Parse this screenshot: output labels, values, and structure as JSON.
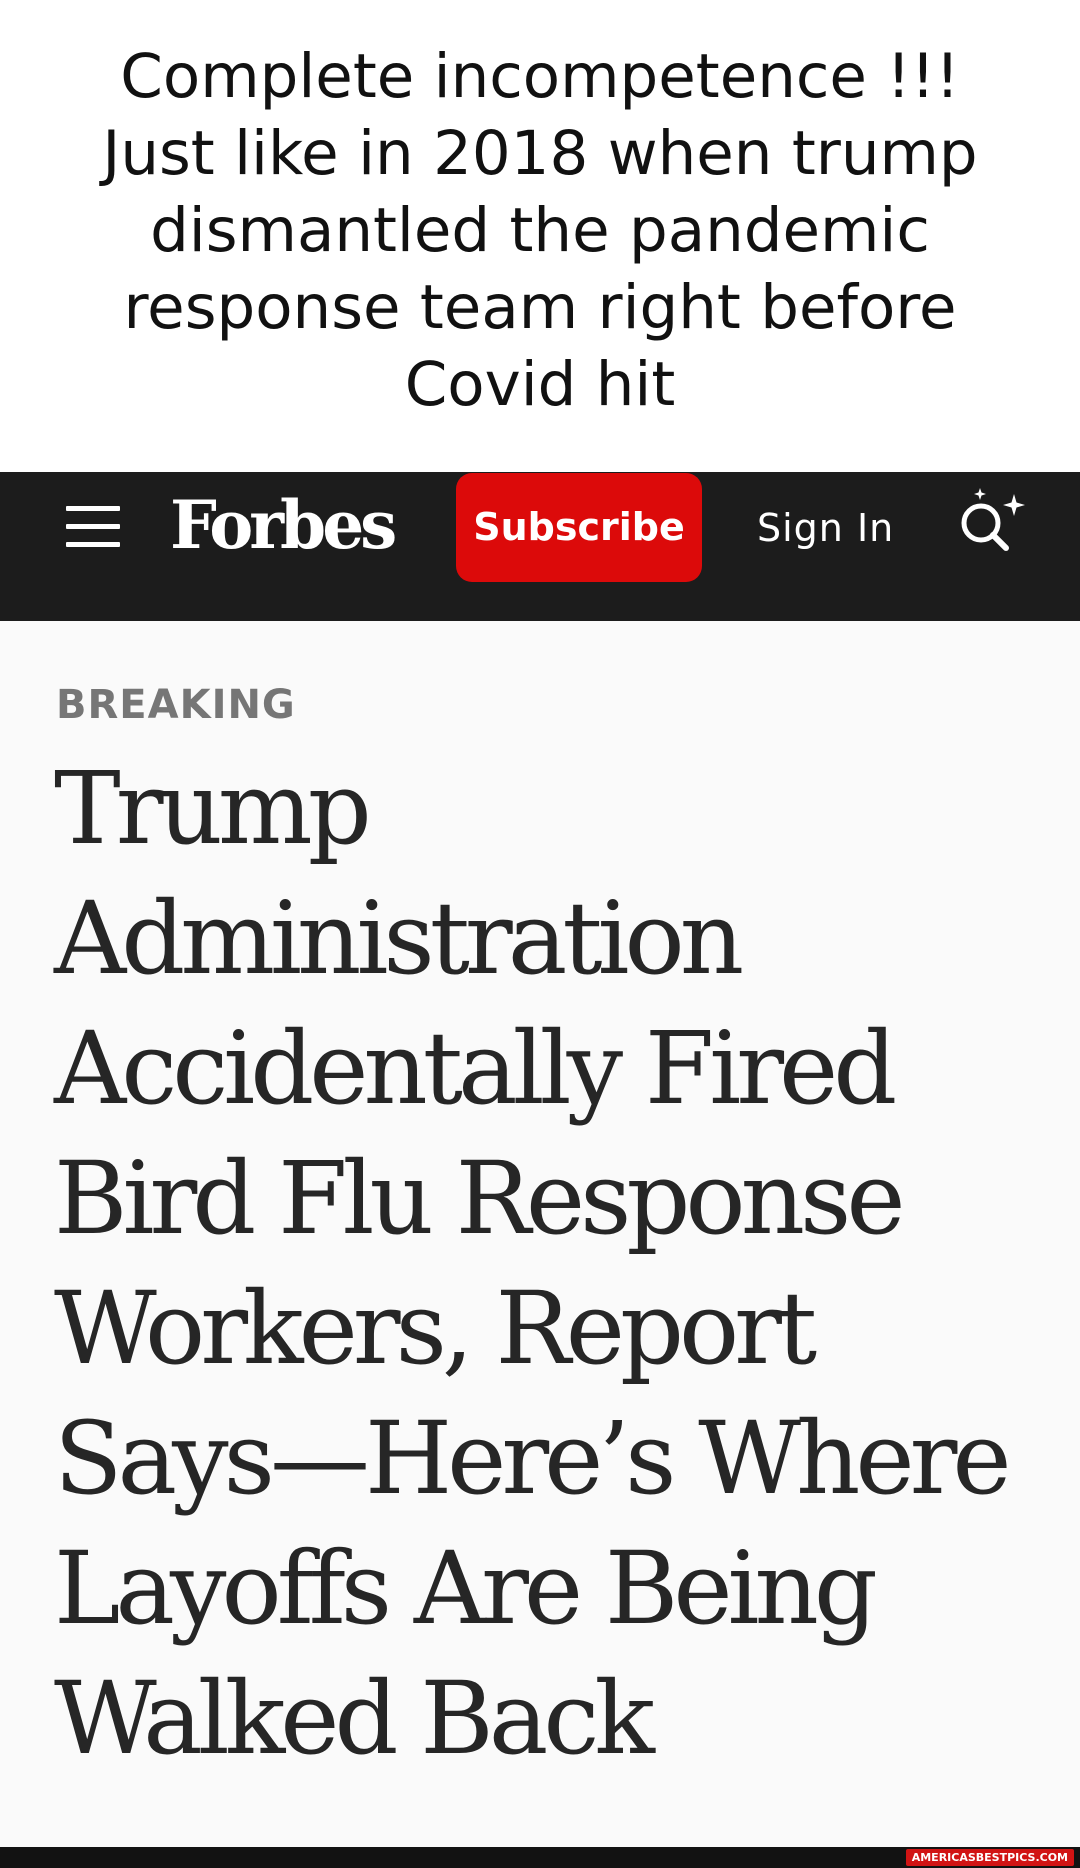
{
  "caption": {
    "text": "Complete incompetence  !!!\nJust like in 2018  when trump\ndismantled the pandemic\nresponse team   right before\nCovid hit"
  },
  "navbar": {
    "menu_icon": "hamburger-menu-icon",
    "logo": "Forbes",
    "subscribe_label": "Subscribe",
    "signin_label": "Sign In",
    "search_icon": "ai-search-icon"
  },
  "article": {
    "kicker": "BREAKING",
    "headline": "Trump Administration Accidentally Fired Bird Flu Response Workers, Report Says—Here’s Where Layoffs Are Being Walked Back"
  },
  "watermark": {
    "text": "AMERICASBESTPICS.COM"
  },
  "colors": {
    "navbar_bg": "#1c1c1c",
    "subscribe_bg": "#dc0a0a",
    "article_bg": "#fafafa",
    "kicker": "#767676",
    "headline": "#262626"
  }
}
